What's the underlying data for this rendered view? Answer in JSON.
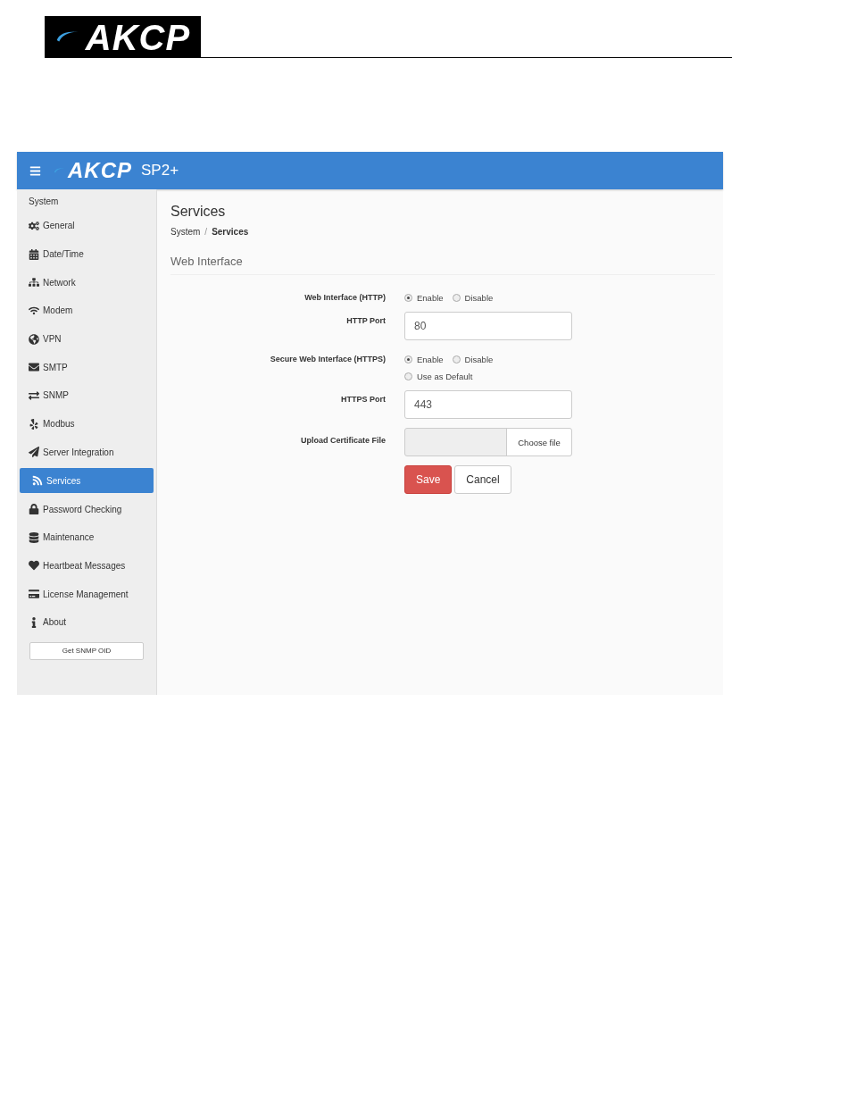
{
  "document_header": {
    "logo": "AKCP"
  },
  "top_bar": {
    "logo": "AKCP",
    "product": "SP2+"
  },
  "sidebar": {
    "section": "System",
    "items": [
      {
        "label": "General",
        "selected": false
      },
      {
        "label": "Date/Time",
        "selected": false
      },
      {
        "label": "Network",
        "selected": false
      },
      {
        "label": "Modem",
        "selected": false
      },
      {
        "label": "VPN",
        "selected": false
      },
      {
        "label": "SMTP",
        "selected": false
      },
      {
        "label": "SNMP",
        "selected": false
      },
      {
        "label": "Modbus",
        "selected": false
      },
      {
        "label": "Server Integration",
        "selected": false
      },
      {
        "label": "Services",
        "selected": true
      },
      {
        "label": "Password Checking",
        "selected": false
      },
      {
        "label": "Maintenance",
        "selected": false
      },
      {
        "label": "Heartbeat Messages",
        "selected": false
      },
      {
        "label": "License Management",
        "selected": false
      },
      {
        "label": "About",
        "selected": false
      }
    ],
    "button": "Get SNMP OID"
  },
  "page": {
    "title": "Services",
    "breadcrumb_separator": "/",
    "breadcrumb": [
      {
        "label": "System",
        "current": false
      },
      {
        "label": "Services",
        "current": true
      }
    ],
    "section": "Web Interface",
    "form": [
      {
        "kind": "radio",
        "label": "Web Interface (HTTP)",
        "options": [
          {
            "label": "Enable",
            "selected": true
          },
          {
            "label": "Disable",
            "selected": false
          }
        ]
      },
      {
        "kind": "input",
        "label": "HTTP Port",
        "value": "80"
      },
      {
        "kind": "radio",
        "label": "Secure Web Interface (HTTPS)",
        "options": [
          {
            "label": "Enable",
            "selected": true
          },
          {
            "label": "Disable",
            "selected": false
          }
        ],
        "extra": {
          "label": "Use as Default",
          "checked": false
        }
      },
      {
        "kind": "input",
        "label": "HTTPS Port",
        "value": "443"
      },
      {
        "kind": "file",
        "label": "Upload Certificate File",
        "button": "Choose file"
      }
    ],
    "actions": [
      {
        "label": "Save",
        "kind": "primary"
      },
      {
        "label": "Cancel",
        "kind": "default"
      }
    ]
  }
}
